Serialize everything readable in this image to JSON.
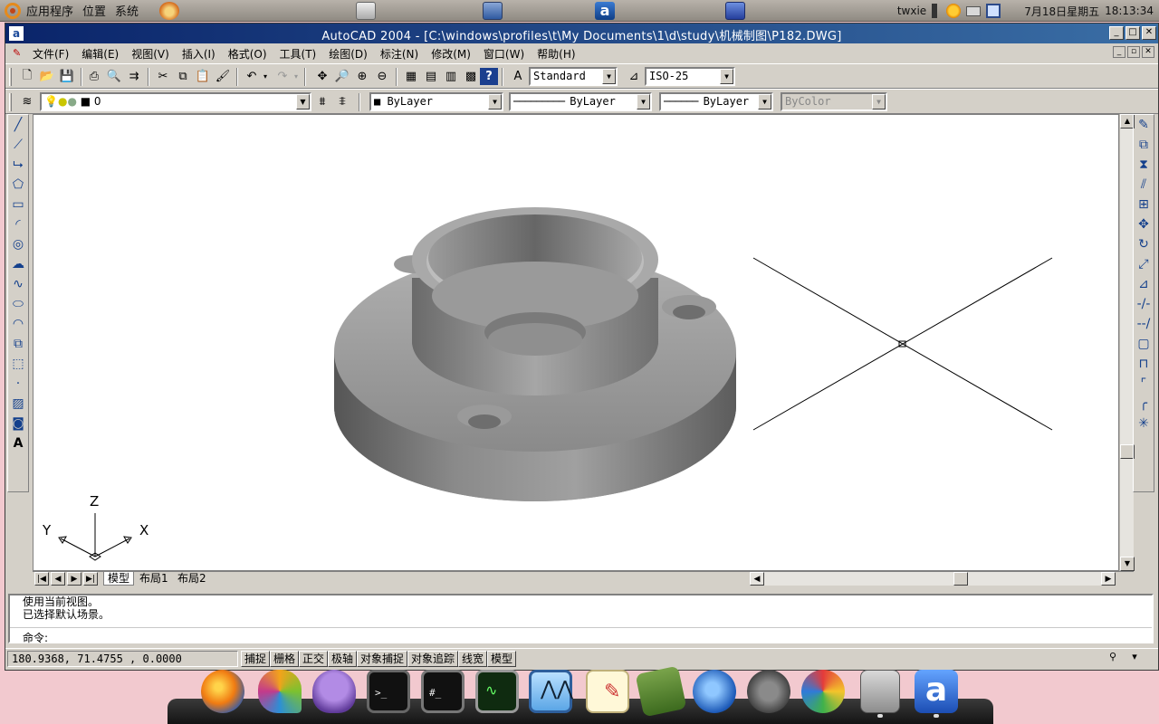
{
  "panel": {
    "menus": [
      "应用程序",
      "位置",
      "系统"
    ],
    "user": "twxie",
    "date": "7月18日星期五",
    "time": "18:13:34"
  },
  "window": {
    "title": "AutoCAD 2004 - [C:\\windows\\profiles\\t\\My Documents\\1\\d\\study\\机械制图\\P182.DWG]"
  },
  "menubar": {
    "items": [
      "文件(F)",
      "编辑(E)",
      "视图(V)",
      "插入(I)",
      "格式(O)",
      "工具(T)",
      "绘图(D)",
      "标注(N)",
      "修改(M)",
      "窗口(W)",
      "帮助(H)"
    ]
  },
  "toolbar": {
    "text_style": "Standard",
    "dim_style": "ISO-25",
    "layer": "0",
    "color": "ByLayer",
    "linetype": "ByLayer",
    "lineweight": "ByLayer",
    "plotstyle": "ByColor"
  },
  "ucs": {
    "x": "X",
    "y": "Y",
    "z": "Z"
  },
  "tabs": [
    "模型",
    "布局1",
    "布局2"
  ],
  "command": {
    "history": [
      "使用当前视图。",
      "已选择默认场景。"
    ],
    "prompt": "命令:"
  },
  "status": {
    "coords": "180.9368, 71.4755 , 0.0000",
    "buttons": [
      "捕捉",
      "栅格",
      "正交",
      "极轴",
      "对象捕捉",
      "对象追踪",
      "线宽",
      "模型"
    ]
  },
  "colors": {
    "title_bar": "#0a246a",
    "chrome": "#d4d0c8",
    "desktop": "#f2c9cf"
  },
  "dock": [
    "firefox-icon",
    "pidgin-icon",
    "empathy-icon",
    "terminal-icon",
    "terminal-icon",
    "system-monitor-icon",
    "analyzer-icon",
    "text-editor-icon",
    "book-icon",
    "browser-icon",
    "settings-icon",
    "picasa-icon",
    "file-cabinet-icon",
    "autocad-icon"
  ]
}
